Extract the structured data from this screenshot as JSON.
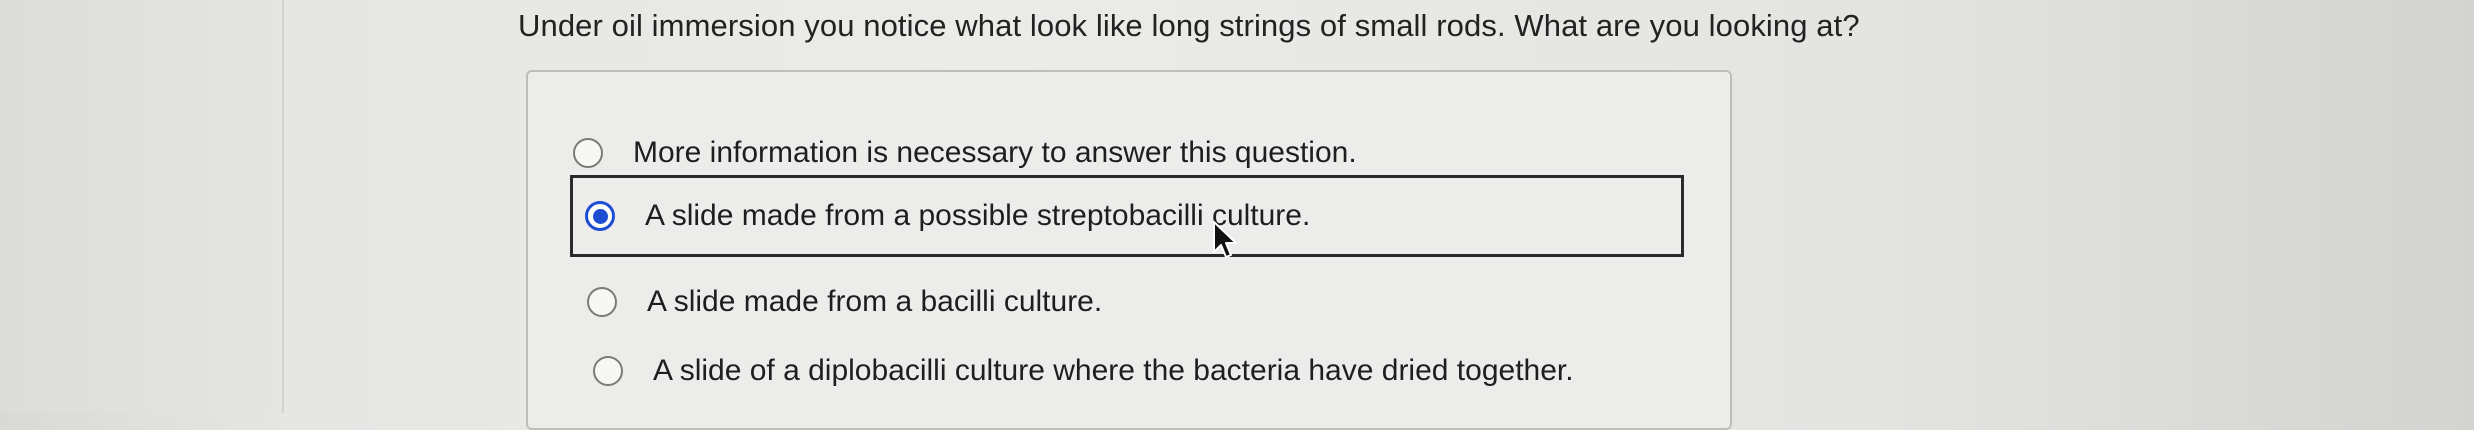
{
  "question": {
    "text": "Under oil immersion you notice what look like long strings of small rods. What are you looking at?"
  },
  "options": [
    {
      "label": "More information is necessary to answer this question.",
      "selected": false
    },
    {
      "label": "A slide made from a possible streptobacilli culture.",
      "selected": true
    },
    {
      "label": "A slide made from a bacilli culture.",
      "selected": false
    },
    {
      "label": "A slide of a diplobacilli culture where the bacteria have dried together.",
      "selected": false
    }
  ],
  "colors": {
    "radio_selected": "#1d4ed1",
    "background": "#e8e8e5"
  },
  "icons": {
    "cursor": "mouse-pointer-icon"
  }
}
